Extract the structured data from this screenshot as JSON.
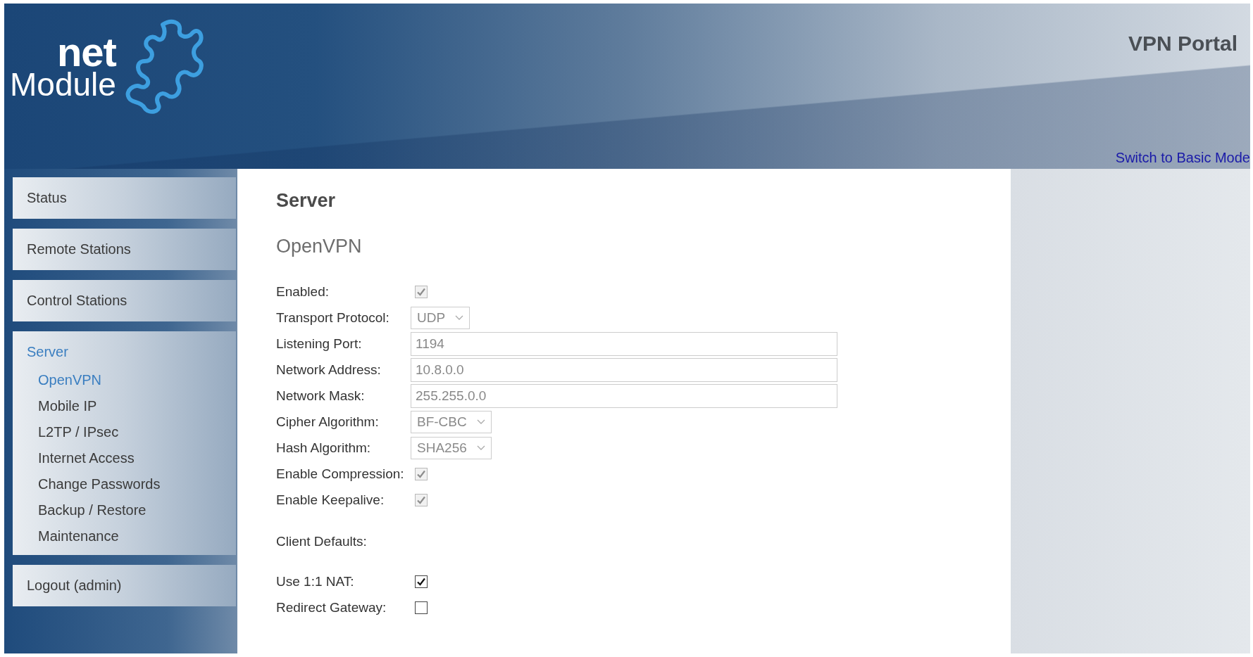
{
  "header": {
    "logo_top": "net",
    "logo_bottom": "Module",
    "title": "VPN Portal",
    "mode_link": "Switch to Basic Mode"
  },
  "nav": [
    {
      "label": "Status",
      "selected": false
    },
    {
      "label": "Remote Stations",
      "selected": false
    },
    {
      "label": "Control Stations",
      "selected": false
    },
    {
      "label": "Server",
      "selected": true,
      "children": [
        {
          "label": "OpenVPN",
          "selected": true
        },
        {
          "label": "Mobile IP",
          "selected": false
        },
        {
          "label": "L2TP / IPsec",
          "selected": false
        },
        {
          "label": "Internet Access",
          "selected": false
        },
        {
          "label": "Change Passwords",
          "selected": false
        },
        {
          "label": "Backup / Restore",
          "selected": false
        },
        {
          "label": "Maintenance",
          "selected": false
        }
      ]
    },
    {
      "label": "Logout (admin)",
      "selected": false
    }
  ],
  "page": {
    "title": "Server",
    "subtitle": "OpenVPN"
  },
  "form": [
    {
      "kind": "checkbox",
      "label": "Enabled:",
      "checked": true,
      "disabled": true
    },
    {
      "kind": "select",
      "label": "Transport Protocol:",
      "value": "UDP",
      "disabled": true
    },
    {
      "kind": "text",
      "label": "Listening Port:",
      "value": "1194",
      "disabled": true
    },
    {
      "kind": "text",
      "label": "Network Address:",
      "value": "10.8.0.0",
      "disabled": true
    },
    {
      "kind": "text",
      "label": "Network Mask:",
      "value": "255.255.0.0",
      "disabled": true
    },
    {
      "kind": "select",
      "label": "Cipher Algorithm:",
      "value": "BF-CBC",
      "disabled": true
    },
    {
      "kind": "select",
      "label": "Hash Algorithm:",
      "value": "SHA256",
      "disabled": true
    },
    {
      "kind": "checkbox",
      "label": "Enable Compression:",
      "checked": true,
      "disabled": true
    },
    {
      "kind": "checkbox",
      "label": "Enable Keepalive:",
      "checked": true,
      "disabled": true
    },
    {
      "kind": "section",
      "label": "Client Defaults:"
    },
    {
      "kind": "checkbox",
      "label": "Use 1:1 NAT:",
      "checked": true,
      "disabled": false
    },
    {
      "kind": "checkbox",
      "label": "Redirect Gateway:",
      "checked": false,
      "disabled": false
    }
  ]
}
